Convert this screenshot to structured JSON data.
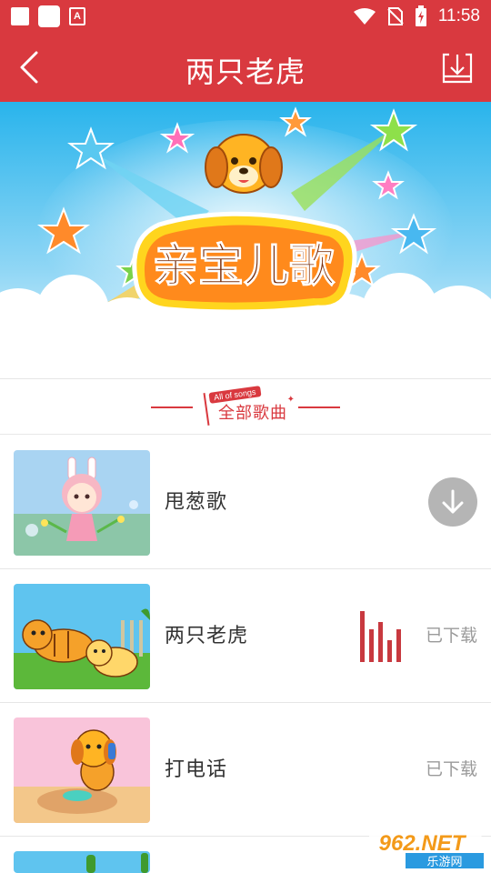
{
  "status_bar": {
    "time": "11:58",
    "notification_icons": [
      "square-icon",
      "square-icon",
      "a-icon"
    ],
    "system_icons": [
      "wifi-icon",
      "no-sim-icon",
      "battery-icon"
    ]
  },
  "app_bar": {
    "title": "两只老虎",
    "back_icon": "chevron-left-icon",
    "download_icon": "download-box-icon",
    "background": "#d9393f"
  },
  "banner": {
    "logo_text": "亲宝儿歌"
  },
  "section": {
    "tag": "All of songs",
    "label": "全部歌曲"
  },
  "songs": [
    {
      "name": "甩葱歌",
      "status": "download",
      "thumb": "bunny-girl"
    },
    {
      "name": "两只老虎",
      "status": "已下载",
      "playing": true,
      "thumb": "tigers"
    },
    {
      "name": "打电话",
      "status": "已下载",
      "thumb": "puppy-phone"
    },
    {
      "name": "",
      "status": "",
      "thumb": "cactus"
    }
  ],
  "watermark": {
    "brand": "962.NET",
    "sub": "乐游网"
  },
  "colors": {
    "accent": "#d9393f",
    "muted_text": "#9a9a9a",
    "download_circle": "#b5b5b5"
  }
}
